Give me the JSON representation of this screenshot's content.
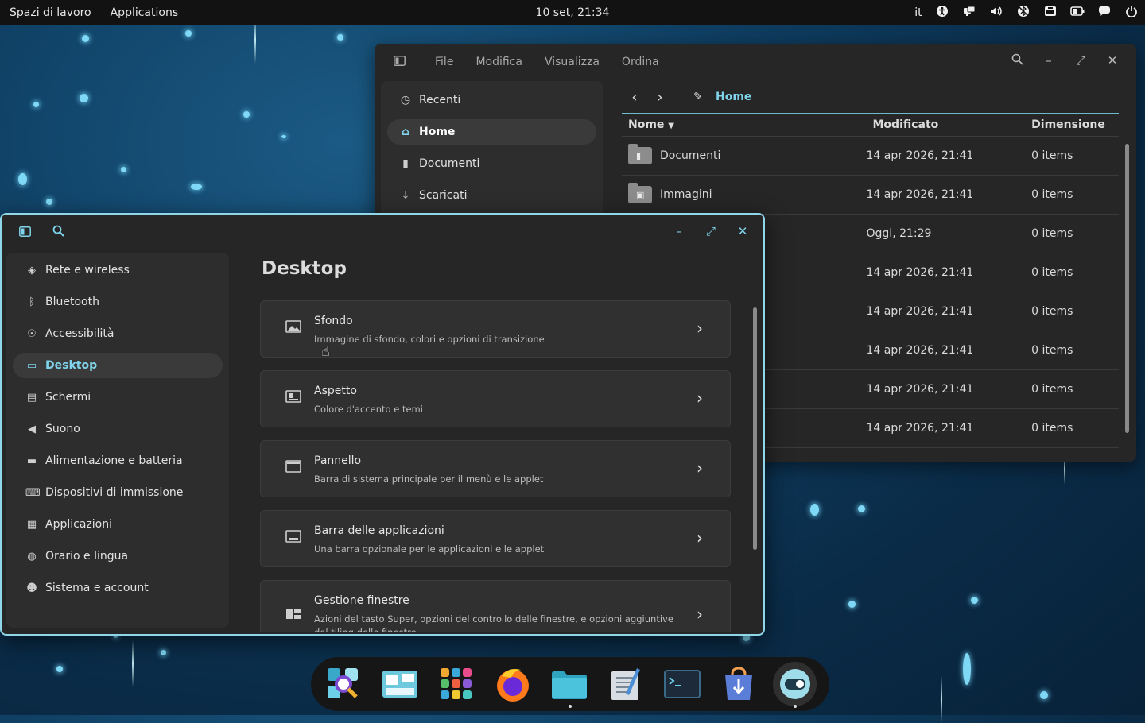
{
  "topbar": {
    "workspaces": "Spazi di lavoro",
    "applications": "Applications",
    "clock": "10 set, 21:34",
    "lang": "it",
    "tray_icons": [
      "accessibility-icon",
      "network-icon",
      "volume-icon",
      "bluetooth-icon",
      "screenshot-icon",
      "battery-icon",
      "notifications-icon",
      "power-icon"
    ]
  },
  "files": {
    "menus": [
      "File",
      "Modifica",
      "Visualizza",
      "Ordina"
    ],
    "sidebar": [
      {
        "label": "Recenti",
        "icon": "clock-icon"
      },
      {
        "label": "Home",
        "icon": "home-icon",
        "active": true
      },
      {
        "label": "Documenti",
        "icon": "document-icon"
      },
      {
        "label": "Scaricati",
        "icon": "download-icon"
      }
    ],
    "path": "Home",
    "columns": {
      "name": "Nome",
      "modified": "Modificato",
      "size": "Dimensione"
    },
    "rows": [
      {
        "name": "Documenti",
        "modified": "14 apr 2026, 21:41",
        "size": "0 items"
      },
      {
        "name": "Immagini",
        "modified": "14 apr 2026, 21:41",
        "size": "0 items"
      },
      {
        "name": "",
        "modified": "Oggi, 21:29",
        "size": "0 items"
      },
      {
        "name": "",
        "modified": "14 apr 2026, 21:41",
        "size": "0 items"
      },
      {
        "name": "",
        "modified": "14 apr 2026, 21:41",
        "size": "0 items"
      },
      {
        "name": "",
        "modified": "14 apr 2026, 21:41",
        "size": "0 items"
      },
      {
        "name": "",
        "modified": "14 apr 2026, 21:41",
        "size": "0 items"
      },
      {
        "name": "",
        "modified": "14 apr 2026, 21:41",
        "size": "0 items"
      }
    ]
  },
  "settings": {
    "sidebar": [
      {
        "label": "Rete e wireless",
        "icon": "wifi-icon"
      },
      {
        "label": "Bluetooth",
        "icon": "bluetooth-icon"
      },
      {
        "label": "Accessibilità",
        "icon": "accessibility-icon"
      },
      {
        "label": "Desktop",
        "icon": "monitor-icon",
        "active": true
      },
      {
        "label": "Schermi",
        "icon": "display-icon"
      },
      {
        "label": "Suono",
        "icon": "speaker-icon"
      },
      {
        "label": "Alimentazione e batteria",
        "icon": "battery-icon"
      },
      {
        "label": "Dispositivi di immissione",
        "icon": "keyboard-icon"
      },
      {
        "label": "Applicazioni",
        "icon": "apps-grid-icon"
      },
      {
        "label": "Orario e lingua",
        "icon": "globe-clock-icon"
      },
      {
        "label": "Sistema e account",
        "icon": "users-icon"
      }
    ],
    "title": "Desktop",
    "cards": [
      {
        "title": "Sfondo",
        "subtitle": "Immagine di sfondo, colori e opzioni di transizione",
        "icon": "image-icon"
      },
      {
        "title": "Aspetto",
        "subtitle": "Colore d'accento e temi",
        "icon": "appearance-icon"
      },
      {
        "title": "Pannello",
        "subtitle": "Barra di sistema principale per il menù e le applet",
        "icon": "panel-icon"
      },
      {
        "title": "Barra delle applicazioni",
        "subtitle": "Una barra opzionale per le applicazioni e le applet",
        "icon": "dock-icon"
      },
      {
        "title": "Gestione finestre",
        "subtitle": "Azioni del tasto Super, opzioni del controllo delle finestre, e opzioni aggiuntive del tiling delle finestre",
        "icon": "window-management-icon"
      }
    ]
  },
  "dock": {
    "apps": [
      "launcher-search-icon",
      "workspaces-icon",
      "app-library-icon",
      "firefox-icon",
      "files-icon",
      "text-editor-icon",
      "terminal-icon",
      "store-icon",
      "settings-icon"
    ],
    "running": [
      "files-icon",
      "settings-icon"
    ]
  },
  "colors": {
    "accent": "#7fd3ea",
    "window": "#262626",
    "sidebar": "#2d2d2d",
    "panel": "#121212"
  }
}
